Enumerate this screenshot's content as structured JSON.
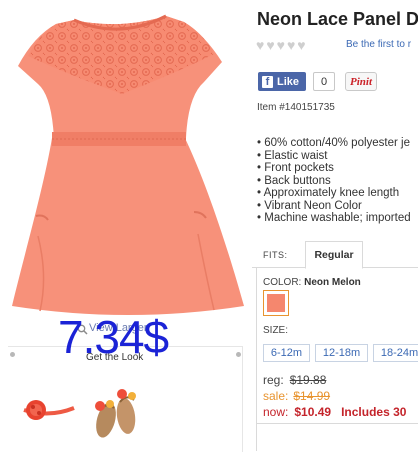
{
  "product": {
    "title": "Neon Lace Panel D",
    "rating_stars": 0,
    "review_link": "Be the first to r",
    "like_label": "Like",
    "like_count": "0",
    "pin_label": "Pinit",
    "item_number": "Item #140151735",
    "features": [
      "60% cotton/40% polyester je",
      "Elastic waist",
      "Front pockets",
      "Back buttons",
      "Approximately knee length",
      "Vibrant Neon Color",
      "Machine washable; imported"
    ]
  },
  "fit": {
    "label": "FITS:",
    "tabs": [
      "Regular"
    ]
  },
  "color": {
    "label": "COLOR:",
    "selected": "Neon Melon",
    "swatch_hex": "#f5876e"
  },
  "size": {
    "label": "SIZE:",
    "options": [
      "6-12m",
      "12-18m",
      "18-24m"
    ]
  },
  "pricing": {
    "reg_label": "reg:",
    "reg_value": "$19.88",
    "sale_label": "sale:",
    "sale_value": "$14.99",
    "now_label": "now:",
    "now_value": "$10.49",
    "includes_text": "Includes 30"
  },
  "gallery": {
    "view_larger": "View Larger",
    "price_overlay": "7.34$"
  },
  "look": {
    "title": "Get the Look"
  },
  "colors": {
    "dress": "#f7917a",
    "link": "#3b69b4",
    "sale": "#e8942f",
    "now": "#c4242b",
    "overlay": "#1b23d6"
  }
}
